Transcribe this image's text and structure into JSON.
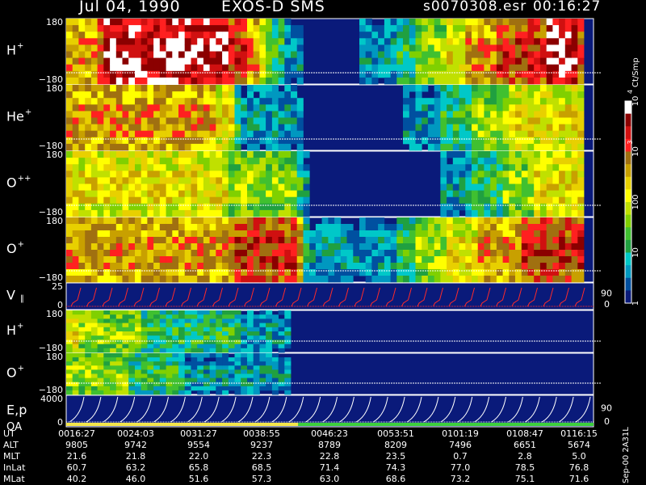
{
  "header": {
    "date": "Jul 04, 1990",
    "instrument": "EXOS-D SMS",
    "file": "s0070308.esr",
    "time": "00:16:27"
  },
  "colors": {
    "background": "#000000",
    "panel_fill": "#0a1a7a",
    "velocity_trace": "#ff2a2a",
    "energy_trace": "#ffffff",
    "qa_yellow": "#f4e64a",
    "qa_green": "#3ccf3c"
  },
  "colorbar": {
    "unit": "Ct/Smp",
    "tick_labels": [
      "10",
      "10",
      "100",
      "10",
      "1"
    ],
    "tick_exponents": [
      "4",
      "3",
      "",
      "",
      ""
    ],
    "tick_values": [
      10000,
      1000,
      100,
      10,
      1
    ],
    "colors_top_to_bottom": [
      "#ffffff",
      "#8b0000",
      "#d01010",
      "#ff2020",
      "#a07010",
      "#c8a000",
      "#e8d000",
      "#ffff00",
      "#c0e000",
      "#80d000",
      "#40c030",
      "#20a040",
      "#00c8c8",
      "#0098c0",
      "#0050a0",
      "#0a1a7a"
    ]
  },
  "chart_data": {
    "type": "heatmap",
    "panels": [
      {
        "label": "H",
        "superscript": "+",
        "ymax": "180",
        "ymin": "−180",
        "intensity": [
          5,
          5,
          5,
          5,
          5,
          6,
          7,
          7,
          7,
          7,
          7,
          7,
          7,
          7,
          7,
          7,
          7,
          7,
          7,
          7,
          7,
          7,
          7,
          7,
          7,
          7,
          6,
          6,
          6,
          5,
          5,
          4,
          3,
          2,
          2,
          1,
          1,
          1,
          0,
          0,
          0,
          0,
          0,
          0,
          0,
          0,
          0,
          1,
          1,
          1,
          1,
          1,
          1,
          2,
          2,
          2,
          3,
          3,
          3,
          3,
          3,
          4,
          4,
          4,
          5,
          5,
          5,
          5,
          5,
          6,
          6,
          6,
          6,
          6,
          6,
          6,
          6,
          7,
          7,
          7,
          7,
          7,
          6
        ]
      },
      {
        "label": "He",
        "superscript": "+",
        "ymax": "180",
        "ymin": "−180",
        "intensity": [
          5,
          5,
          5,
          5,
          5,
          5,
          5,
          5,
          5,
          5,
          5,
          5,
          5,
          5,
          5,
          5,
          5,
          5,
          5,
          5,
          5,
          5,
          5,
          5,
          4,
          4,
          4,
          2,
          1,
          1,
          1,
          1,
          1,
          1,
          1,
          1,
          1,
          1,
          0,
          0,
          0,
          0,
          0,
          0,
          0,
          0,
          0,
          0,
          0,
          0,
          0,
          0,
          0,
          0,
          1,
          1,
          1,
          1,
          1,
          1,
          2,
          2,
          2,
          2,
          2,
          3,
          3,
          3,
          3,
          3,
          3,
          4,
          4,
          4,
          4,
          4,
          4,
          4,
          4,
          4,
          4,
          4,
          4
        ]
      },
      {
        "label": "O",
        "superscript": "++",
        "ymax": "180",
        "ymin": "−180",
        "intensity": [
          4,
          4,
          4,
          4,
          4,
          4,
          4,
          4,
          4,
          4,
          4,
          4,
          4,
          4,
          4,
          4,
          4,
          4,
          4,
          4,
          4,
          4,
          4,
          4,
          4,
          4,
          3,
          3,
          3,
          3,
          3,
          3,
          3,
          3,
          3,
          3,
          3,
          2,
          1,
          0,
          0,
          0,
          0,
          0,
          0,
          0,
          0,
          0,
          0,
          0,
          0,
          0,
          0,
          0,
          0,
          0,
          0,
          0,
          0,
          0,
          1,
          1,
          1,
          1,
          1,
          2,
          2,
          2,
          2,
          2,
          3,
          3,
          3,
          3,
          3,
          4,
          4,
          4,
          4,
          4,
          4,
          4,
          4
        ]
      },
      {
        "label": "O",
        "superscript": "+",
        "ymax": "180",
        "ymin": "−180",
        "intensity": [
          5,
          5,
          5,
          5,
          5,
          5,
          5,
          5,
          5,
          5,
          5,
          5,
          5,
          5,
          5,
          5,
          5,
          5,
          5,
          5,
          5,
          5,
          5,
          5,
          5,
          5,
          5,
          6,
          6,
          6,
          6,
          6,
          6,
          6,
          6,
          6,
          6,
          5,
          2,
          1,
          1,
          1,
          1,
          1,
          1,
          1,
          1,
          1,
          1,
          1,
          1,
          1,
          1,
          2,
          2,
          2,
          3,
          3,
          3,
          3,
          3,
          4,
          4,
          4,
          4,
          4,
          5,
          5,
          5,
          5,
          5,
          5,
          5,
          6,
          6,
          6,
          6,
          6,
          6,
          6,
          6,
          6,
          6
        ]
      },
      {
        "label": "V",
        "subscript": "∥",
        "superscript": "",
        "ymax": "25",
        "ymin": "0",
        "right_label": "90",
        "right_label_bottom": "0"
      },
      {
        "label": "H",
        "superscript": "+",
        "ymax": "180",
        "ymin": "−180",
        "intensity": [
          4,
          4,
          3,
          3,
          3,
          3,
          3,
          3,
          3,
          3,
          3,
          3,
          2,
          2,
          2,
          2,
          2,
          2,
          2,
          2,
          2,
          2,
          2,
          2,
          2,
          2,
          2,
          2,
          1,
          1,
          1,
          1,
          1,
          1,
          1,
          1,
          0,
          0,
          0,
          0,
          0,
          0,
          0,
          0,
          0,
          0,
          0,
          0,
          0,
          0,
          0,
          0,
          0,
          0,
          0,
          0,
          0,
          0,
          0,
          0,
          0,
          0,
          0,
          0,
          0,
          0,
          0,
          0,
          0,
          0,
          0,
          0,
          0,
          0,
          0,
          0,
          0,
          0,
          0,
          0,
          0,
          0,
          0
        ]
      },
      {
        "label": "O",
        "superscript": "+",
        "ymax": "180",
        "ymin": "−180",
        "intensity": [
          3,
          3,
          3,
          3,
          3,
          3,
          3,
          3,
          3,
          3,
          2,
          2,
          2,
          2,
          2,
          2,
          2,
          2,
          2,
          1,
          1,
          1,
          1,
          1,
          1,
          1,
          1,
          1,
          1,
          1,
          1,
          1,
          1,
          1,
          1,
          1,
          0,
          0,
          0,
          0,
          0,
          0,
          0,
          0,
          0,
          0,
          0,
          0,
          0,
          0,
          0,
          0,
          0,
          0,
          0,
          0,
          0,
          0,
          0,
          0,
          0,
          0,
          0,
          0,
          0,
          0,
          0,
          0,
          0,
          0,
          0,
          0,
          0,
          0,
          0,
          0,
          0,
          0,
          0,
          0,
          0,
          0,
          0
        ]
      },
      {
        "label": "E,p",
        "label2": "QA",
        "ymax": "4000",
        "ymin": "0",
        "right_label": "90",
        "right_label_bottom": "0"
      }
    ],
    "ephemeris": {
      "row_labels": [
        "UT",
        "ALT",
        "MLT",
        "InLat",
        "MLat"
      ],
      "UT": [
        "0016:27",
        "0024:03",
        "0031:27",
        "0038:55",
        "0046:23",
        "0053:51",
        "0101:19",
        "0108:47",
        "0116:15"
      ],
      "ALT": [
        "9805",
        "9742",
        "9554",
        "9237",
        "8789",
        "8209",
        "7496",
        "6651",
        "5674"
      ],
      "MLT": [
        "21.6",
        "21.8",
        "22.0",
        "22.3",
        "22.8",
        "23.5",
        "0.7",
        "2.8",
        "5.0"
      ],
      "InLat": [
        "60.7",
        "63.2",
        "65.8",
        "68.5",
        "71.4",
        "74.3",
        "77.0",
        "78.5",
        "76.8"
      ],
      "MLat": [
        "40.2",
        "46.0",
        "51.6",
        "57.3",
        "63.0",
        "68.6",
        "73.2",
        "75.1",
        "71.6"
      ]
    },
    "qa_bar": {
      "yellow_fraction": 0.44,
      "green_fraction": 0.56
    }
  },
  "footer": {
    "side_code": "Sep-00 2A31L"
  }
}
